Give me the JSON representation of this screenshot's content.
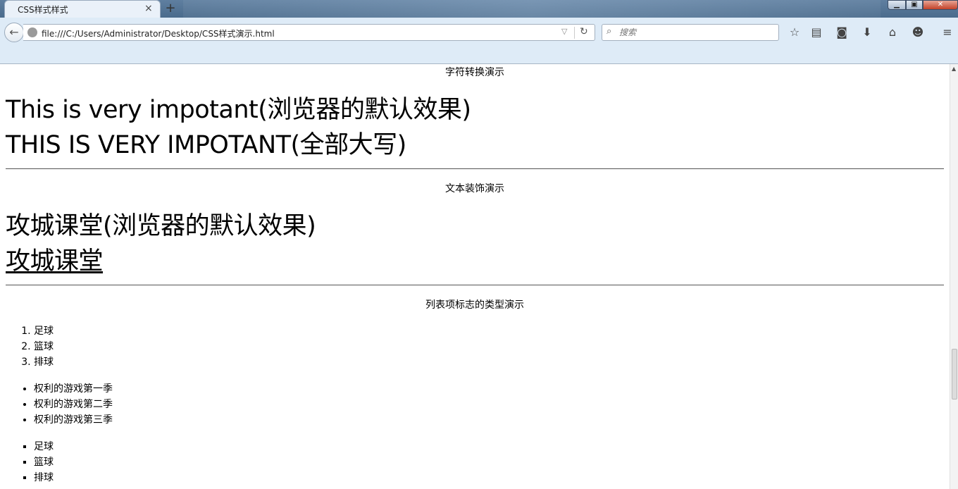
{
  "browser": {
    "tab_title": "CSS样式样式",
    "tab_close": "×",
    "new_tab": "+",
    "url": "file:///C:/Users/Administrator/Desktop/CSS样式演示.html",
    "search_placeholder": "搜索",
    "icons": [
      "back-arrow-icon",
      "globe-icon",
      "dropdown-icon",
      "reload-icon",
      "search-icon",
      "star-icon",
      "reading-list-icon",
      "pocket-icon",
      "download-icon",
      "home-icon",
      "chat-icon",
      "menu-icon"
    ]
  },
  "page": {
    "section1": {
      "caption": "字符转换演示",
      "default_line": "This is very impotant(浏览器的默认效果)",
      "upper_line": "This is very impotant(全部大写)"
    },
    "section2": {
      "caption": "文本装饰演示",
      "default_line": "攻城课堂(浏览器的默认效果)",
      "underline_line": "攻城课堂"
    },
    "section3": {
      "caption": "列表项标志的类型演示",
      "ordered_list": [
        "足球",
        "篮球",
        "排球"
      ],
      "disc_list": [
        "权利的游戏第一季",
        "权利的游戏第二季",
        "权利的游戏第三季"
      ],
      "square_list": [
        "足球",
        "篮球",
        "排球"
      ]
    }
  }
}
